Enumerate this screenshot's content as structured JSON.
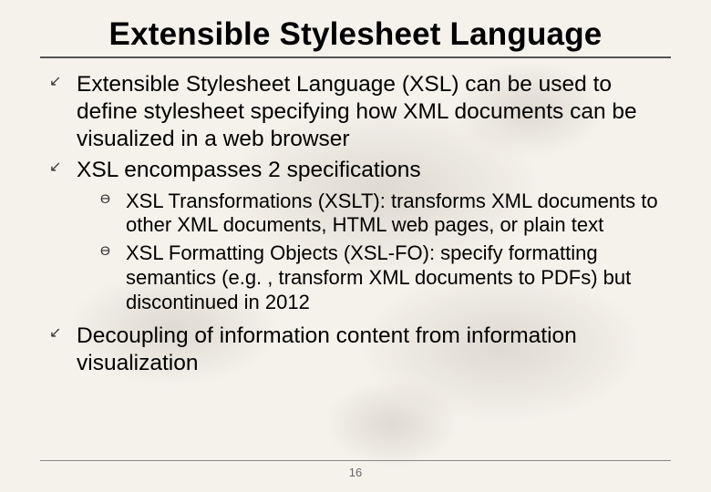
{
  "title": "Extensible Stylesheet Language",
  "bullets": [
    {
      "text": "Extensible Stylesheet Language (XSL) can be used to define stylesheet specifying how XML documents can be visualized in a web browser"
    },
    {
      "text": "XSL encompasses 2 specifications",
      "sub": [
        {
          "text": "XSL Transformations (XSLT): transforms XML documents to other XML documents, HTML web pages, or plain text"
        },
        {
          "text": "XSL Formatting Objects (XSL-FO):  specify formatting semantics (e.g. , transform XML documents to PDFs) but discontinued in 2012"
        }
      ]
    },
    {
      "text": "Decoupling of information content from information visualization"
    }
  ],
  "page_number": "16"
}
